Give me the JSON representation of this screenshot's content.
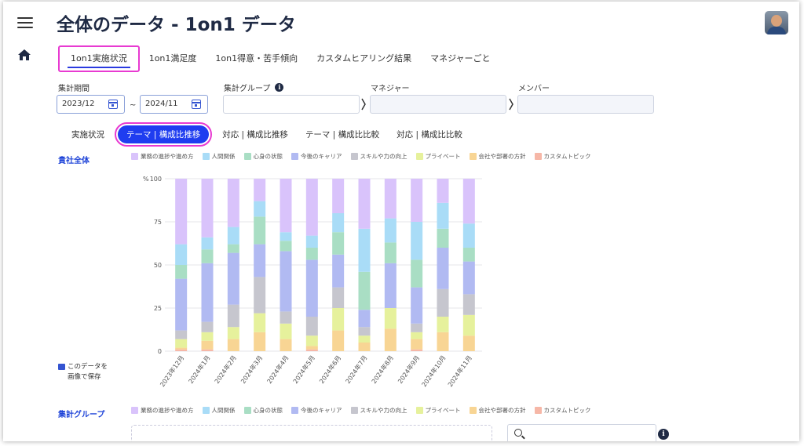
{
  "header": {
    "title": "全体のデータ - 1on1 データ"
  },
  "tabs": [
    {
      "label": "1on1実施状況"
    },
    {
      "label": "1on1満足度"
    },
    {
      "label": "1on1得意・苦手傾向"
    },
    {
      "label": "カスタムヒアリング結果"
    },
    {
      "label": "マネジャーごと"
    }
  ],
  "filters": {
    "period_label": "集計期間",
    "start": "2023/12",
    "tilde": "~",
    "end": "2024/11",
    "group_label": "集計グループ",
    "manager_label": "マネジャー",
    "member_label": "メンバー"
  },
  "subtabs": [
    {
      "label": "実施状況"
    },
    {
      "label": "テーマ | 構成比推移"
    },
    {
      "label": "対応 | 構成比推移"
    },
    {
      "label": "テーマ | 構成比比較"
    },
    {
      "label": "対応 | 構成比比較"
    }
  ],
  "section1_title": "貴社全体",
  "section2_title": "集計グループ",
  "save": {
    "line1": "このデータを",
    "line2": "画像で保存"
  },
  "legend": [
    {
      "name": "業務の進捗や進め方",
      "color": "#d9c3fb"
    },
    {
      "name": "人間関係",
      "color": "#a9dcf7"
    },
    {
      "name": "心身の状態",
      "color": "#a9dec4"
    },
    {
      "name": "今後のキャリア",
      "color": "#b1baf2"
    },
    {
      "name": "スキルや力の向上",
      "color": "#c6c6ce"
    },
    {
      "name": "プライベート",
      "color": "#e6f19c"
    },
    {
      "name": "会社や部署の方針",
      "color": "#f8d594"
    },
    {
      "name": "カスタムトピック",
      "color": "#f6b7a7"
    }
  ],
  "chart_data": {
    "type": "bar",
    "stacked": true,
    "ylabel": "%",
    "ylim": [
      0,
      100
    ],
    "yticks": [
      0,
      25,
      50,
      75,
      100
    ],
    "grid": true,
    "legend_position": "top",
    "categories": [
      "2023年12月",
      "2024年1月",
      "2024年2月",
      "2024年3月",
      "2024年4月",
      "2024年5月",
      "2024年6月",
      "2024年7月",
      "2024年8月",
      "2024年9月",
      "2024年10月",
      "2024年11月"
    ],
    "series": [
      {
        "name": "カスタムトピック",
        "values": [
          1,
          1,
          0,
          0,
          0,
          1,
          0,
          0,
          0,
          1,
          0,
          0
        ]
      },
      {
        "name": "会社や部署の方針",
        "values": [
          1,
          5,
          7,
          11,
          7,
          2,
          12,
          5,
          13,
          6,
          11,
          9
        ]
      },
      {
        "name": "プライベート",
        "values": [
          5,
          5,
          7,
          11,
          9,
          6,
          13,
          4,
          12,
          4,
          9,
          12
        ]
      },
      {
        "name": "スキルや力の向上",
        "values": [
          5,
          6,
          13,
          21,
          7,
          11,
          12,
          5,
          0,
          5,
          16,
          12
        ]
      },
      {
        "name": "今後のキャリア",
        "values": [
          30,
          34,
          30,
          19,
          35,
          33,
          19,
          10,
          26,
          21,
          24,
          19
        ]
      },
      {
        "name": "心身の状態",
        "values": [
          8,
          8,
          5,
          16,
          6,
          7,
          13,
          22,
          12,
          16,
          11,
          8
        ]
      },
      {
        "name": "人間関係",
        "values": [
          12,
          7,
          10,
          9,
          5,
          7,
          11,
          25,
          14,
          22,
          15,
          14
        ]
      },
      {
        "name": "業務の進捗や進め方",
        "values": [
          38,
          34,
          28,
          13,
          31,
          33,
          20,
          29,
          23,
          25,
          14,
          26
        ]
      }
    ]
  }
}
